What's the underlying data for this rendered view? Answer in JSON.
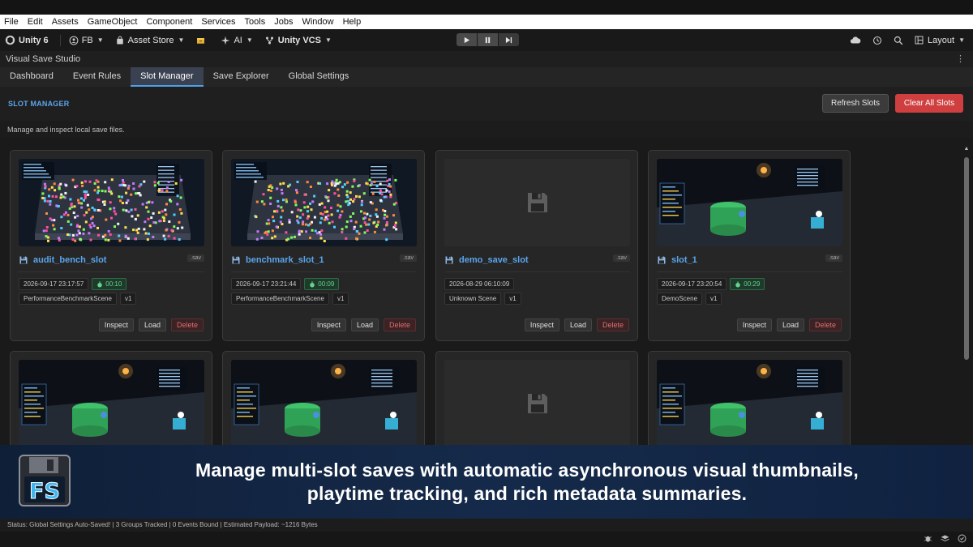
{
  "menu": [
    "File",
    "Edit",
    "Assets",
    "GameObject",
    "Component",
    "Services",
    "Tools",
    "Jobs",
    "Window",
    "Help"
  ],
  "toolbar": {
    "unity_label": "Unity 6",
    "account_label": "FB",
    "asset_store_label": "Asset Store",
    "ai_label": "AI",
    "vcs_label": "Unity VCS",
    "layout_label": "Layout"
  },
  "window_title": "Visual Save Studio",
  "tabs": [
    {
      "label": "Dashboard"
    },
    {
      "label": "Event Rules"
    },
    {
      "label": "Slot Manager",
      "active": true
    },
    {
      "label": "Save Explorer"
    },
    {
      "label": "Global Settings"
    }
  ],
  "header": {
    "title": "SLOT MANAGER",
    "refresh_label": "Refresh Slots",
    "clear_label": "Clear All Slots"
  },
  "description": "Manage and inspect local save files.",
  "slots": [
    {
      "name": "audit_bench_slot",
      "ext": ".sav",
      "date": "2026-09-17 23:17:57",
      "playtime": "00:10",
      "scene": "PerformanceBenchmarkScene",
      "version": "v1",
      "thumbnail": "benchmark"
    },
    {
      "name": "benchmark_slot_1",
      "ext": ".sav",
      "date": "2026-09-17 23:21:44",
      "playtime": "00:09",
      "scene": "PerformanceBenchmarkScene",
      "version": "v1",
      "thumbnail": "benchmark"
    },
    {
      "name": "demo_save_slot",
      "ext": ".sav",
      "date": "2026-08-29 06:10:09",
      "playtime": "",
      "scene": "Unknown Scene",
      "version": "v1",
      "thumbnail": "none"
    },
    {
      "name": "slot_1",
      "ext": ".sav",
      "date": "2026-09-17 23:20:54",
      "playtime": "00:29",
      "scene": "DemoScene",
      "version": "v1",
      "thumbnail": "demo"
    }
  ],
  "second_row_thumbnails": [
    "demo",
    "demo",
    "none",
    "demo"
  ],
  "actions": {
    "inspect": "Inspect",
    "load": "Load",
    "delete": "Delete"
  },
  "banner": {
    "line1": "Manage multi-slot saves with automatic asynchronous visual thumbnails,",
    "line2": "playtime tracking, and rich metadata summaries."
  },
  "status": "Status: Global Settings Auto-Saved! | 3 Groups Tracked | 0 Events Bound | Estimated Payload: ~1216 Bytes",
  "colors": {
    "accent": "#5aa5ec",
    "danger": "#cf3f3f",
    "playtime": "#67d38e"
  }
}
